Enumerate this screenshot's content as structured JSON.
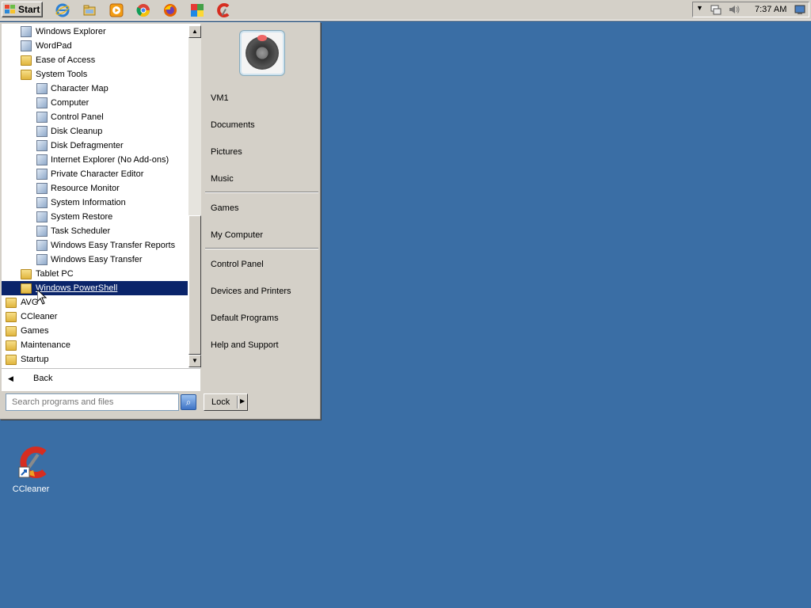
{
  "taskbar": {
    "start_label": "Start",
    "quick_launch": [
      "internet-explorer-icon",
      "windows-explorer-icon",
      "media-player-icon",
      "chrome-icon",
      "firefox-icon",
      "avg-icon",
      "ccleaner-icon"
    ],
    "clock": "7:37 AM"
  },
  "start_menu": {
    "programs": [
      {
        "label": "Windows Explorer",
        "icon": "windows-explorer-icon",
        "level": 1
      },
      {
        "label": "WordPad",
        "icon": "wordpad-icon",
        "level": 1
      },
      {
        "label": "Ease of Access",
        "icon": "folder-icon",
        "level": 1
      },
      {
        "label": "System Tools",
        "icon": "folder-icon",
        "level": 1
      },
      {
        "label": "Character Map",
        "icon": "character-map-icon",
        "level": 2
      },
      {
        "label": "Computer",
        "icon": "computer-icon",
        "level": 2
      },
      {
        "label": "Control Panel",
        "icon": "control-panel-icon",
        "level": 2
      },
      {
        "label": "Disk Cleanup",
        "icon": "disk-cleanup-icon",
        "level": 2
      },
      {
        "label": "Disk Defragmenter",
        "icon": "disk-defragmenter-icon",
        "level": 2
      },
      {
        "label": "Internet Explorer (No Add-ons)",
        "icon": "internet-explorer-icon",
        "level": 2
      },
      {
        "label": "Private Character Editor",
        "icon": "private-character-editor-icon",
        "level": 2
      },
      {
        "label": "Resource Monitor",
        "icon": "resource-monitor-icon",
        "level": 2
      },
      {
        "label": "System Information",
        "icon": "system-information-icon",
        "level": 2
      },
      {
        "label": "System Restore",
        "icon": "system-restore-icon",
        "level": 2
      },
      {
        "label": "Task Scheduler",
        "icon": "task-scheduler-icon",
        "level": 2
      },
      {
        "label": "Windows Easy Transfer Reports",
        "icon": "easy-transfer-reports-icon",
        "level": 2
      },
      {
        "label": "Windows Easy Transfer",
        "icon": "easy-transfer-icon",
        "level": 2
      },
      {
        "label": "Tablet PC",
        "icon": "folder-icon",
        "level": 1
      },
      {
        "label": "Windows PowerShell",
        "icon": "folder-icon",
        "level": 1,
        "selected": true
      },
      {
        "label": "AVG",
        "icon": "folder-icon",
        "level": 0
      },
      {
        "label": "CCleaner",
        "icon": "folder-icon",
        "level": 0
      },
      {
        "label": "Games",
        "icon": "folder-icon",
        "level": 0
      },
      {
        "label": "Maintenance",
        "icon": "folder-icon",
        "level": 0
      },
      {
        "label": "Startup",
        "icon": "folder-icon",
        "level": 0
      }
    ],
    "back_label": "Back",
    "search_placeholder": "Search programs and files",
    "right_items": {
      "user": "VM1",
      "documents": "Documents",
      "pictures": "Pictures",
      "music": "Music",
      "games": "Games",
      "my_computer": "My Computer",
      "control_panel": "Control Panel",
      "devices_printers": "Devices and Printers",
      "default_programs": "Default Programs",
      "help_support": "Help and Support"
    },
    "lock_label": "Lock"
  },
  "desktop": {
    "ccleaner_label": "CCleaner"
  },
  "colors": {
    "desktop": "#3a6ea5",
    "selection": "#0a246a",
    "chrome": "#d4d0c8"
  }
}
